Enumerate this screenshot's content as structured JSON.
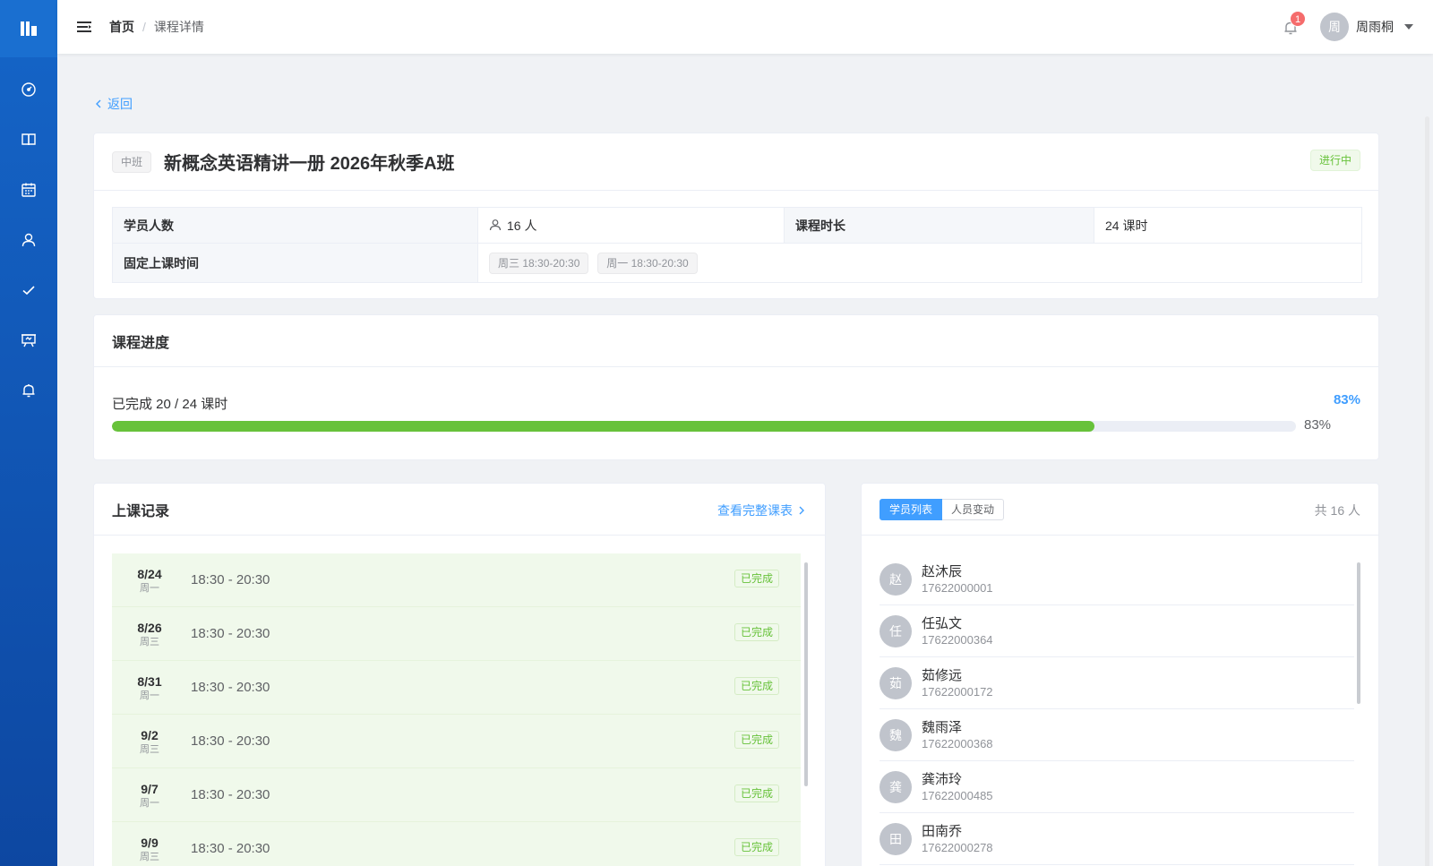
{
  "sidebar": {
    "items": [
      {
        "icon": "dashboard-icon"
      },
      {
        "icon": "book-icon"
      },
      {
        "icon": "calendar-icon"
      },
      {
        "icon": "user-icon"
      },
      {
        "icon": "check-icon"
      },
      {
        "icon": "presentation-icon"
      },
      {
        "icon": "bell-icon"
      }
    ]
  },
  "header": {
    "breadcrumb_home": "首页",
    "breadcrumb_sep": "/",
    "breadcrumb_current": "课程详情",
    "notification_count": "1",
    "user_avatar_char": "周",
    "user_name": "周雨桐"
  },
  "back_label": "返回",
  "course": {
    "level_tag": "中班",
    "title": "新概念英语精讲一册 2026年秋季A班",
    "status": "进行中",
    "students_label": "学员人数",
    "students_value": "16 人",
    "duration_label": "课程时长",
    "duration_value": "24 课时",
    "schedule_label": "固定上课时间",
    "schedule_times": [
      "周三 18:30-20:30",
      "周一 18:30-20:30"
    ]
  },
  "progress": {
    "title": "课程进度",
    "completed_label": "已完成 20 / 24 课时",
    "percent_text": "83%",
    "bar_text": "83%",
    "fraction": 0.83
  },
  "records": {
    "title": "上课记录",
    "view_all": "查看完整课表",
    "items": [
      {
        "date": "8/24",
        "weekday": "周一",
        "time": "18:30 - 20:30",
        "status": "已完成"
      },
      {
        "date": "8/26",
        "weekday": "周三",
        "time": "18:30 - 20:30",
        "status": "已完成"
      },
      {
        "date": "8/31",
        "weekday": "周一",
        "time": "18:30 - 20:30",
        "status": "已完成"
      },
      {
        "date": "9/2",
        "weekday": "周三",
        "time": "18:30 - 20:30",
        "status": "已完成"
      },
      {
        "date": "9/7",
        "weekday": "周一",
        "time": "18:30 - 20:30",
        "status": "已完成"
      },
      {
        "date": "9/9",
        "weekday": "周三",
        "time": "18:30 - 20:30",
        "status": "已完成"
      }
    ]
  },
  "students": {
    "tab_list": "学员列表",
    "tab_changes": "人员变动",
    "total": "共 16 人",
    "items": [
      {
        "avatar": "赵",
        "name": "赵沐辰",
        "phone": "17622000001"
      },
      {
        "avatar": "任",
        "name": "任弘文",
        "phone": "17622000364"
      },
      {
        "avatar": "茹",
        "name": "茹修远",
        "phone": "17622000172"
      },
      {
        "avatar": "魏",
        "name": "魏雨泽",
        "phone": "17622000368"
      },
      {
        "avatar": "龚",
        "name": "龚沛玲",
        "phone": "17622000485"
      },
      {
        "avatar": "田",
        "name": "田南乔",
        "phone": "17622000278"
      }
    ]
  },
  "colors": {
    "sidebar": "#1565c8",
    "primary": "#409eff",
    "success": "#67c23a",
    "danger": "#f56c6c"
  }
}
